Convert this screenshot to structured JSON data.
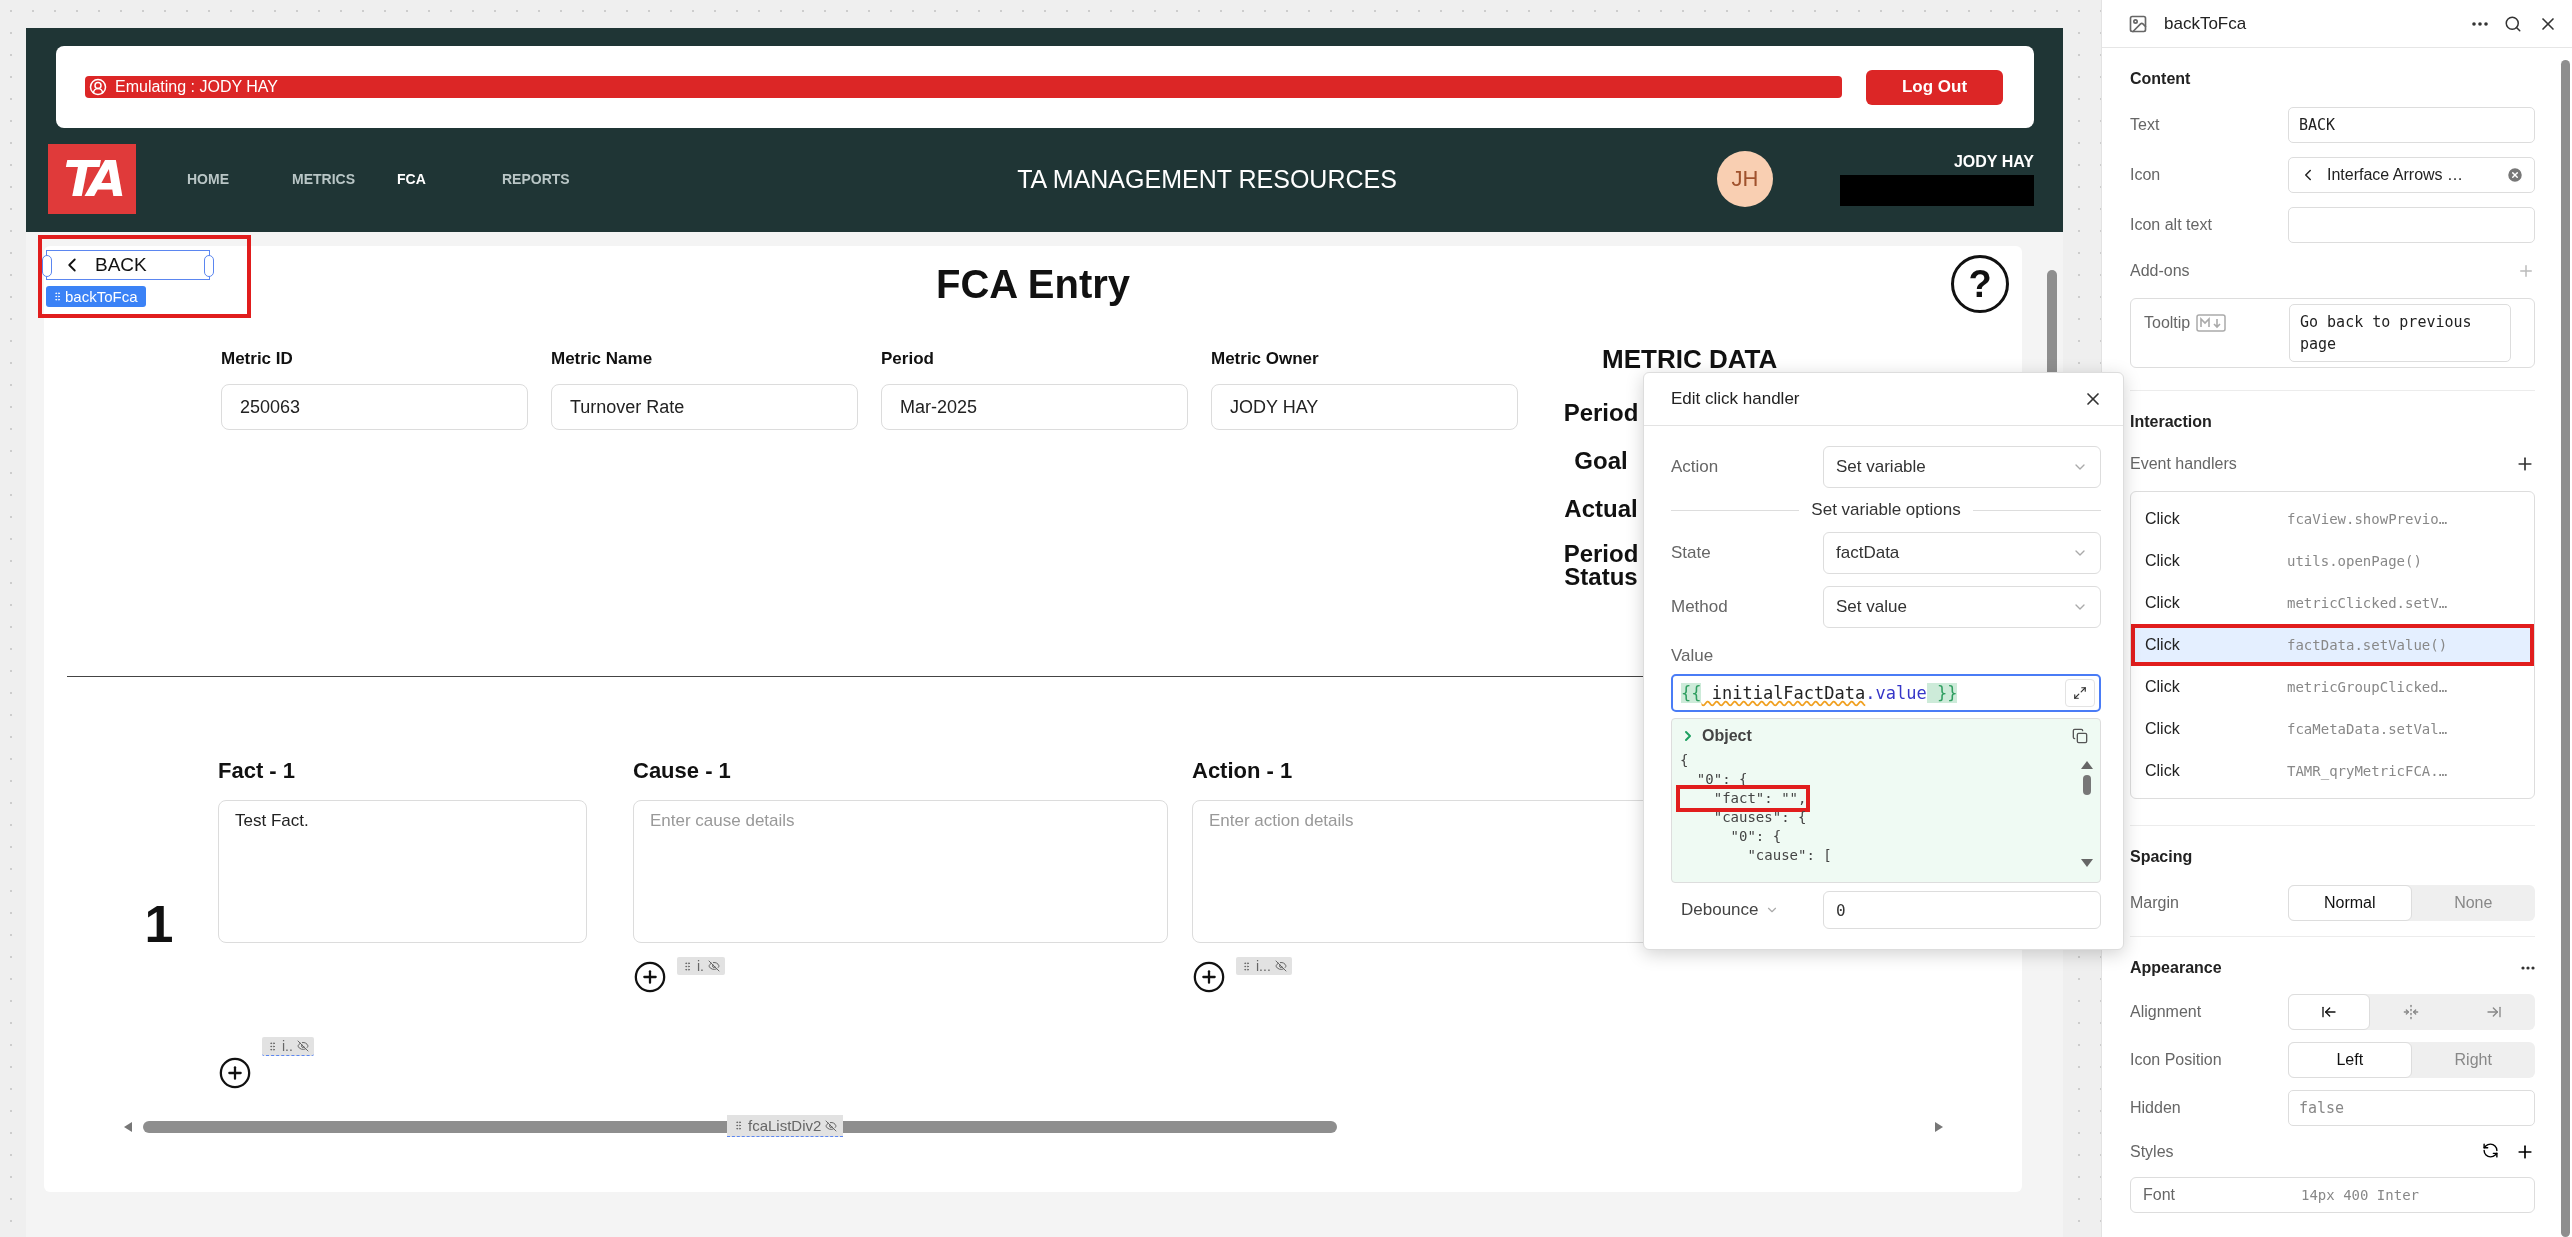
{
  "emulation": {
    "label": "Emulating : JODY HAY",
    "logout": "Log Out"
  },
  "nav": {
    "logo": "TA",
    "items": [
      {
        "label": "HOME",
        "selected": false
      },
      {
        "label": "METRICS",
        "selected": false
      },
      {
        "label": "FCA",
        "selected": true
      },
      {
        "label": "REPORTS",
        "selected": false
      }
    ],
    "title": "TA MANAGEMENT RESOURCES",
    "avatar": "JH",
    "user_name": "JODY HAY"
  },
  "canvas": {
    "back_button": {
      "label": "BACK",
      "component_name": "backToFca",
      "selected": true,
      "highlighted": true
    },
    "title": "FCA Entry",
    "help": "?",
    "metric_fields": [
      {
        "label": "Metric ID",
        "value": "250063"
      },
      {
        "label": "Metric Name",
        "value": "Turnover Rate"
      },
      {
        "label": "Period",
        "value": "Mar-2025"
      },
      {
        "label": "Metric Owner",
        "value": "JODY HAY"
      }
    ],
    "metric_data": {
      "title": "METRIC DATA",
      "labels": [
        "Period",
        "Goal",
        "Actual",
        "Period Status"
      ]
    },
    "fca_row": {
      "number": "1",
      "columns": [
        {
          "heading": "Fact - 1",
          "value": "Test Fact."
        },
        {
          "heading": "Cause - 1",
          "placeholder": "Enter cause details",
          "chip": "i."
        },
        {
          "heading": "Action - 1",
          "placeholder": "Enter action details",
          "chip": "i..."
        }
      ],
      "add_chip": "i.."
    },
    "list_chip": "fcaListDiv2"
  },
  "popup": {
    "title": "Edit click handler",
    "action": {
      "label": "Action",
      "value": "Set variable"
    },
    "section": "Set variable options",
    "options": [
      {
        "label": "State",
        "value": "factData"
      },
      {
        "label": "Method",
        "value": "Set value"
      }
    ],
    "value_label": "Value",
    "value_tokens": [
      {
        "text": "{{",
        "kind": "brace"
      },
      {
        "text": " initialFactData",
        "kind": "ident"
      },
      {
        "text": ".value",
        "kind": "prop"
      },
      {
        "text": " }}",
        "kind": "brace"
      }
    ],
    "preview": {
      "type": "Object",
      "lines": [
        {
          "text": "{",
          "highlighted": false
        },
        {
          "text": "  \"0\": {",
          "highlighted": false
        },
        {
          "text": "    \"fact\": \"\",",
          "highlighted": true
        },
        {
          "text": "    \"causes\": {",
          "highlighted": false
        },
        {
          "text": "      \"0\": {",
          "highlighted": false
        },
        {
          "text": "        \"cause\": [",
          "highlighted": false
        }
      ]
    },
    "debounce": {
      "label": "Debounce",
      "value": "0"
    }
  },
  "inspector": {
    "title": "backToFca",
    "content": {
      "heading": "Content",
      "text_label": "Text",
      "text_value": "BACK",
      "icon_label": "Icon",
      "icon_value": "Interface Arrows …",
      "alt_label": "Icon alt text",
      "addons_label": "Add-ons",
      "tooltip_label": "Tooltip",
      "tooltip_value": "Go back to previous page"
    },
    "interaction": {
      "heading": "Interaction",
      "handlers_label": "Event handlers",
      "handlers": [
        {
          "event": "Click",
          "action": "fcaView.showPrevio…",
          "selected": false,
          "highlighted": false
        },
        {
          "event": "Click",
          "action": "utils.openPage()",
          "selected": false,
          "highlighted": false
        },
        {
          "event": "Click",
          "action": "metricClicked.setV…",
          "selected": false,
          "highlighted": false
        },
        {
          "event": "Click",
          "action": "factData.setValue()",
          "selected": true,
          "highlighted": true
        },
        {
          "event": "Click",
          "action": "metricGroupClicked…",
          "selected": false,
          "highlighted": false
        },
        {
          "event": "Click",
          "action": "fcaMetaData.setVal…",
          "selected": false,
          "highlighted": false
        },
        {
          "event": "Click",
          "action": "TAMR_qryMetricFCA.…",
          "selected": false,
          "highlighted": false
        }
      ]
    },
    "spacing": {
      "heading": "Spacing",
      "margin_label": "Margin",
      "options": [
        {
          "label": "Normal",
          "selected": true
        },
        {
          "label": "None",
          "selected": false
        }
      ]
    },
    "appearance": {
      "heading": "Appearance",
      "alignment_label": "Alignment",
      "alignments": [
        {
          "kind": "left",
          "selected": true
        },
        {
          "kind": "center",
          "selected": false
        },
        {
          "kind": "right",
          "selected": false
        }
      ],
      "icon_position_label": "Icon Position",
      "icon_positions": [
        {
          "label": "Left",
          "selected": true
        },
        {
          "label": "Right",
          "selected": false
        }
      ],
      "hidden_label": "Hidden",
      "hidden_value": "false",
      "styles_label": "Styles",
      "font_label": "Font",
      "font_value": "14px 400 Inter"
    }
  }
}
